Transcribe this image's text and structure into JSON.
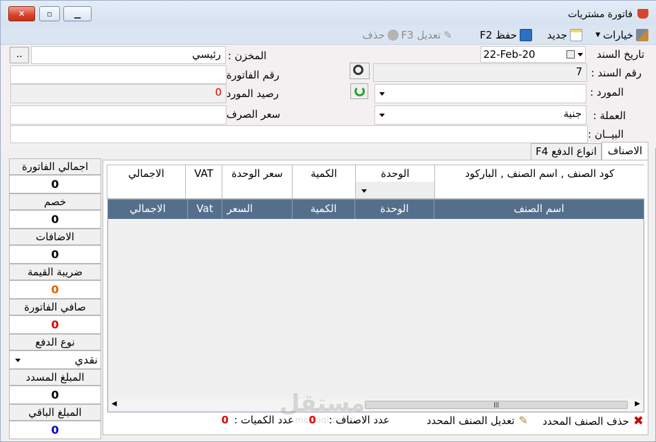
{
  "window": {
    "title": "فاتورة مشتريات"
  },
  "toolbar": {
    "options": "خيارات",
    "new": "جديد",
    "save": "حفظ F2",
    "edit": "تعديل F3",
    "delete": "حذف"
  },
  "form": {
    "doc_date_label": "تاريخ السند",
    "doc_date_value": "22-Feb-20",
    "doc_no_label": "رقم السند :",
    "doc_no_value": "7",
    "supplier_label": "المورد :",
    "supplier_value": "",
    "currency_label": "العملة :",
    "currency_value": "جنية",
    "statement_label": "البيــان :",
    "statement_value": "",
    "store_label": "المخزن :",
    "store_value": "رئيسي",
    "store_browse": "..",
    "invoice_no_label": "رقم الفاتورة :",
    "invoice_no_value": "",
    "supplier_balance_label": "رصيد المورد :",
    "supplier_balance_value": "0",
    "exchange_rate_label": "سعر الصرف :",
    "exchange_rate_value": ""
  },
  "tabs": {
    "items": "الاصناف",
    "payment": "انواع الدفع F4"
  },
  "entry": {
    "headers": {
      "code": "كود الصنف , اسم الصنف , الباركود",
      "unit": "الوحدة",
      "qty": "الكمية",
      "unit_price": "سعر الوحدة",
      "vat": "VAT",
      "total": "الاجمالي"
    }
  },
  "grid": {
    "headers": {
      "name": "اسم الصنف",
      "unit": "الوحدة",
      "qty": "الكمية",
      "price": "السعر",
      "vat": "Vat",
      "total": "الاجمالي"
    }
  },
  "totals": {
    "invoice_total_label": "اجمالي الفاتورة",
    "invoice_total": "0",
    "discount_label": "خصم",
    "discount": "0",
    "additions_label": "الاضافات",
    "additions": "0",
    "tax_label": "ضريبة القيمة",
    "tax": "0",
    "net_label": "صافي الفاتورة",
    "net": "0",
    "payment_type_label": "نوع الدفع",
    "payment_type": "نقدي",
    "paid_label": "المبلغ المسدد",
    "paid": "0",
    "remaining_label": "المبلغ الباقي",
    "remaining": "0"
  },
  "status": {
    "delete_item": "حذف الصنف المحدد",
    "edit_item": "تعديل الصنف المحدد",
    "items_count_label": "عدد الاصناف :",
    "items_count": "0",
    "qty_count_label": "عدد الكميات :",
    "qty_count": "0"
  },
  "watermark": {
    "text": "مستقل",
    "subtext": "mostaql.com"
  },
  "colors": {
    "grid_header": "#536f8c",
    "net_value": "#e00000",
    "tax_value": "#e06000",
    "remaining_value": "#0000cc",
    "delete_icon": "#cc0000"
  }
}
